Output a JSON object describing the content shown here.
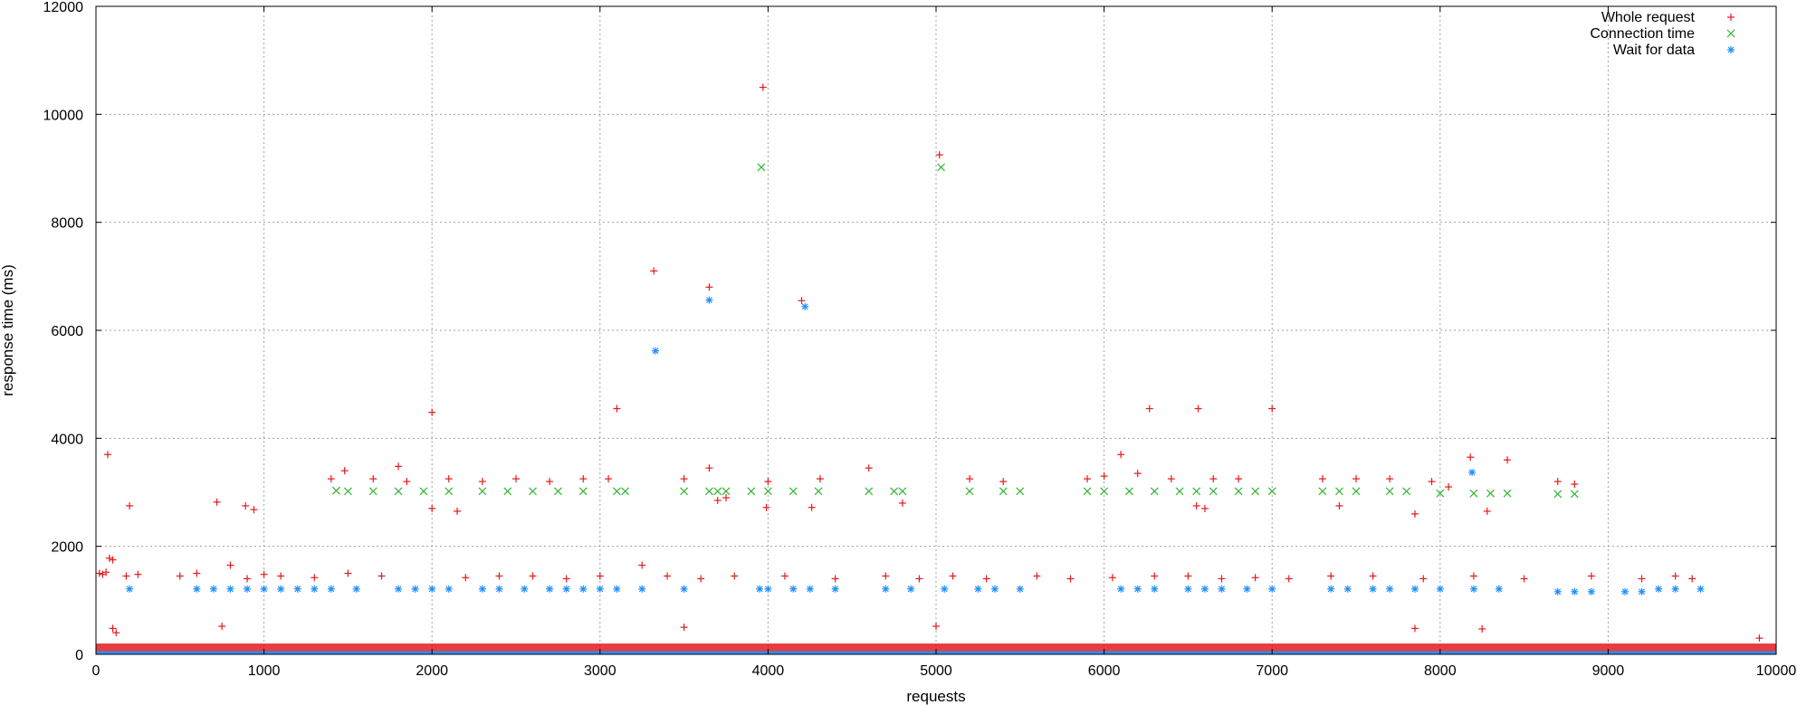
{
  "chart_data": {
    "type": "scatter",
    "title": "",
    "xlabel": "requests",
    "ylabel": "response time (ms)",
    "xlim": [
      0,
      10000
    ],
    "ylim": [
      0,
      12000
    ],
    "x_ticks": [
      "0",
      "1000",
      "2000",
      "3000",
      "4000",
      "5000",
      "6000",
      "7000",
      "8000",
      "9000",
      "10000"
    ],
    "y_ticks": [
      "0",
      "2000",
      "4000",
      "6000",
      "8000",
      "10000",
      "12000"
    ],
    "grid": true,
    "legend_position": "top-right",
    "series": [
      {
        "name": "Whole request",
        "color": "#e41a1c",
        "marker": "+",
        "points": [
          [
            20,
            1500
          ],
          [
            40,
            1480
          ],
          [
            60,
            1520
          ],
          [
            80,
            1780
          ],
          [
            100,
            1750
          ],
          [
            70,
            3700
          ],
          [
            200,
            2750
          ],
          [
            250,
            1480
          ],
          [
            180,
            1450
          ],
          [
            720,
            2820
          ],
          [
            890,
            2750
          ],
          [
            940,
            2680
          ],
          [
            800,
            1650
          ],
          [
            1000,
            1480
          ],
          [
            1500,
            1500
          ],
          [
            1800,
            3480
          ],
          [
            2000,
            4480
          ],
          [
            2000,
            2700
          ],
          [
            2150,
            2650
          ],
          [
            1400,
            3250
          ],
          [
            1480,
            3400
          ],
          [
            1650,
            3250
          ],
          [
            1850,
            3200
          ],
          [
            2100,
            3250
          ],
          [
            2300,
            3200
          ],
          [
            2500,
            3250
          ],
          [
            2700,
            3200
          ],
          [
            2900,
            3250
          ],
          [
            3050,
            3250
          ],
          [
            3100,
            4550
          ],
          [
            3250,
            1650
          ],
          [
            3320,
            7100
          ],
          [
            3500,
            3250
          ],
          [
            3650,
            6800
          ],
          [
            3650,
            3450
          ],
          [
            3700,
            2850
          ],
          [
            3750,
            2900
          ],
          [
            3970,
            10500
          ],
          [
            3990,
            2720
          ],
          [
            4000,
            3200
          ],
          [
            4200,
            6550
          ],
          [
            4260,
            2720
          ],
          [
            4310,
            3250
          ],
          [
            4600,
            3450
          ],
          [
            4800,
            2800
          ],
          [
            5020,
            9250
          ],
          [
            5200,
            3250
          ],
          [
            5400,
            3200
          ],
          [
            5900,
            3250
          ],
          [
            6000,
            3300
          ],
          [
            6100,
            3700
          ],
          [
            6200,
            3350
          ],
          [
            6270,
            4550
          ],
          [
            6400,
            3250
          ],
          [
            6550,
            2750
          ],
          [
            6560,
            4550
          ],
          [
            6600,
            2700
          ],
          [
            6650,
            3250
          ],
          [
            6800,
            3250
          ],
          [
            7000,
            4550
          ],
          [
            7300,
            3250
          ],
          [
            7400,
            2750
          ],
          [
            7500,
            3250
          ],
          [
            7700,
            3250
          ],
          [
            7850,
            2600
          ],
          [
            7950,
            3200
          ],
          [
            8050,
            3100
          ],
          [
            8180,
            3650
          ],
          [
            8280,
            2650
          ],
          [
            8400,
            3600
          ],
          [
            8700,
            3200
          ],
          [
            8800,
            3150
          ],
          [
            500,
            1450
          ],
          [
            600,
            1500
          ],
          [
            900,
            1400
          ],
          [
            1100,
            1450
          ],
          [
            1300,
            1420
          ],
          [
            1700,
            1450
          ],
          [
            2200,
            1420
          ],
          [
            2400,
            1450
          ],
          [
            2600,
            1450
          ],
          [
            2800,
            1400
          ],
          [
            3000,
            1450
          ],
          [
            3400,
            1450
          ],
          [
            3600,
            1400
          ],
          [
            3800,
            1450
          ],
          [
            4100,
            1450
          ],
          [
            4400,
            1400
          ],
          [
            4700,
            1450
          ],
          [
            4900,
            1400
          ],
          [
            5100,
            1450
          ],
          [
            5300,
            1400
          ],
          [
            5600,
            1450
          ],
          [
            5800,
            1400
          ],
          [
            6050,
            1420
          ],
          [
            6300,
            1450
          ],
          [
            6500,
            1450
          ],
          [
            6700,
            1400
          ],
          [
            6900,
            1420
          ],
          [
            7100,
            1400
          ],
          [
            7350,
            1450
          ],
          [
            7600,
            1450
          ],
          [
            7900,
            1400
          ],
          [
            8200,
            1450
          ],
          [
            8500,
            1400
          ],
          [
            8900,
            1450
          ],
          [
            9200,
            1400
          ],
          [
            9400,
            1450
          ],
          [
            9500,
            1400
          ],
          [
            100,
            480
          ],
          [
            120,
            400
          ],
          [
            750,
            520
          ],
          [
            3500,
            500
          ],
          [
            5000,
            520
          ],
          [
            7850,
            480
          ],
          [
            8250,
            470
          ],
          [
            9900,
            300
          ]
        ]
      },
      {
        "name": "Connection time",
        "color": "#33b533",
        "marker": "x",
        "points": [
          [
            1430,
            3030
          ],
          [
            1500,
            3020
          ],
          [
            1650,
            3020
          ],
          [
            1800,
            3020
          ],
          [
            1950,
            3020
          ],
          [
            2100,
            3020
          ],
          [
            2300,
            3020
          ],
          [
            2450,
            3020
          ],
          [
            2600,
            3020
          ],
          [
            2750,
            3020
          ],
          [
            2900,
            3020
          ],
          [
            3100,
            3020
          ],
          [
            3150,
            3020
          ],
          [
            3500,
            3020
          ],
          [
            3650,
            3020
          ],
          [
            3700,
            3020
          ],
          [
            3750,
            3020
          ],
          [
            3900,
            3020
          ],
          [
            3960,
            9020
          ],
          [
            4000,
            3020
          ],
          [
            4150,
            3020
          ],
          [
            4300,
            3020
          ],
          [
            4600,
            3020
          ],
          [
            4750,
            3020
          ],
          [
            4800,
            3020
          ],
          [
            5030,
            9020
          ],
          [
            5200,
            3020
          ],
          [
            5400,
            3020
          ],
          [
            5500,
            3020
          ],
          [
            5900,
            3020
          ],
          [
            6000,
            3020
          ],
          [
            6150,
            3020
          ],
          [
            6300,
            3020
          ],
          [
            6450,
            3020
          ],
          [
            6550,
            3020
          ],
          [
            6650,
            3020
          ],
          [
            6800,
            3020
          ],
          [
            6900,
            3020
          ],
          [
            7000,
            3020
          ],
          [
            7300,
            3020
          ],
          [
            7400,
            3020
          ],
          [
            7500,
            3020
          ],
          [
            7700,
            3020
          ],
          [
            7800,
            3020
          ],
          [
            8000,
            2980
          ],
          [
            8200,
            2980
          ],
          [
            8300,
            2980
          ],
          [
            8400,
            2980
          ],
          [
            8700,
            2970
          ],
          [
            8800,
            2970
          ]
        ]
      },
      {
        "name": "Wait for data",
        "color": "#1e90ff",
        "marker": "*",
        "points": [
          [
            200,
            1210
          ],
          [
            600,
            1210
          ],
          [
            700,
            1210
          ],
          [
            800,
            1210
          ],
          [
            900,
            1210
          ],
          [
            1000,
            1210
          ],
          [
            1100,
            1210
          ],
          [
            1200,
            1210
          ],
          [
            1300,
            1210
          ],
          [
            1400,
            1210
          ],
          [
            1550,
            1210
          ],
          [
            1800,
            1210
          ],
          [
            1900,
            1210
          ],
          [
            2000,
            1210
          ],
          [
            2100,
            1210
          ],
          [
            2300,
            1210
          ],
          [
            2400,
            1210
          ],
          [
            2550,
            1210
          ],
          [
            2700,
            1210
          ],
          [
            2800,
            1210
          ],
          [
            2900,
            1210
          ],
          [
            3000,
            1210
          ],
          [
            3100,
            1210
          ],
          [
            3250,
            1210
          ],
          [
            3330,
            5620
          ],
          [
            3500,
            1210
          ],
          [
            3650,
            6560
          ],
          [
            3950,
            1210
          ],
          [
            4000,
            1210
          ],
          [
            4150,
            1210
          ],
          [
            4220,
            6440
          ],
          [
            4250,
            1210
          ],
          [
            4400,
            1210
          ],
          [
            4700,
            1210
          ],
          [
            4850,
            1210
          ],
          [
            5050,
            1210
          ],
          [
            5250,
            1210
          ],
          [
            5350,
            1210
          ],
          [
            5500,
            1210
          ],
          [
            6100,
            1210
          ],
          [
            6200,
            1210
          ],
          [
            6300,
            1210
          ],
          [
            6500,
            1210
          ],
          [
            6600,
            1210
          ],
          [
            6700,
            1210
          ],
          [
            6850,
            1210
          ],
          [
            7000,
            1210
          ],
          [
            7350,
            1210
          ],
          [
            7450,
            1210
          ],
          [
            7600,
            1210
          ],
          [
            7700,
            1210
          ],
          [
            7850,
            1210
          ],
          [
            8000,
            1210
          ],
          [
            8190,
            3370
          ],
          [
            8200,
            1210
          ],
          [
            8350,
            1210
          ],
          [
            8700,
            1160
          ],
          [
            8800,
            1160
          ],
          [
            8900,
            1160
          ],
          [
            9100,
            1160
          ],
          [
            9200,
            1160
          ],
          [
            9300,
            1210
          ],
          [
            9400,
            1210
          ],
          [
            9550,
            1210
          ]
        ]
      }
    ],
    "baseline_band": {
      "x_range": [
        0,
        10000
      ],
      "whole_request_y": [
        20,
        200
      ],
      "wait_for_data_y": [
        0,
        60
      ]
    }
  }
}
